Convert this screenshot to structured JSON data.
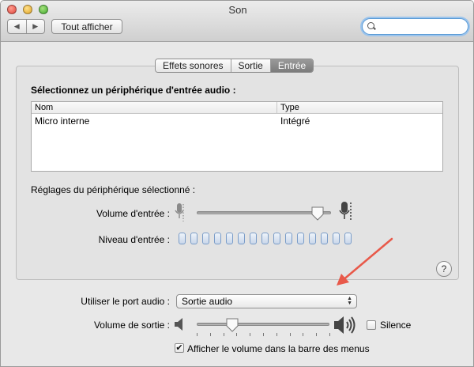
{
  "window": {
    "title": "Son"
  },
  "toolbar": {
    "back_icon": "chevron-left-icon",
    "forward_icon": "chevron-right-icon",
    "show_all_label": "Tout afficher",
    "search_value": ""
  },
  "tabs": [
    {
      "label": "Effets sonores",
      "selected": false
    },
    {
      "label": "Sortie",
      "selected": false
    },
    {
      "label": "Entrée",
      "selected": true
    }
  ],
  "input_panel": {
    "title": "Sélectionnez un périphérique d'entrée audio :",
    "columns": [
      "Nom",
      "Type"
    ],
    "rows": [
      {
        "name": "Micro interne",
        "type": "Intégré"
      }
    ],
    "settings_title": "Réglages du périphérique sélectionné :",
    "input_volume_label": "Volume d'entrée :",
    "input_volume_level": 0.9,
    "input_level_label": "Niveau d'entrée :",
    "input_level_active_segments": 0,
    "input_level_segment_count": 15,
    "help_label": "?"
  },
  "output": {
    "port_label": "Utiliser le port audio :",
    "port_value": "Sortie audio",
    "output_volume_label": "Volume de sortie :",
    "output_volume_level": 0.27,
    "mute_label": "Silence",
    "mute_checked": false,
    "show_in_menubar_label": "Afficher le volume dans la barre des menus",
    "show_in_menubar_checked": true
  },
  "colors": {
    "annotation_arrow": "#e8594a",
    "selected_tab": "#8a8a8a",
    "level_segment": "#7a9cc8"
  }
}
